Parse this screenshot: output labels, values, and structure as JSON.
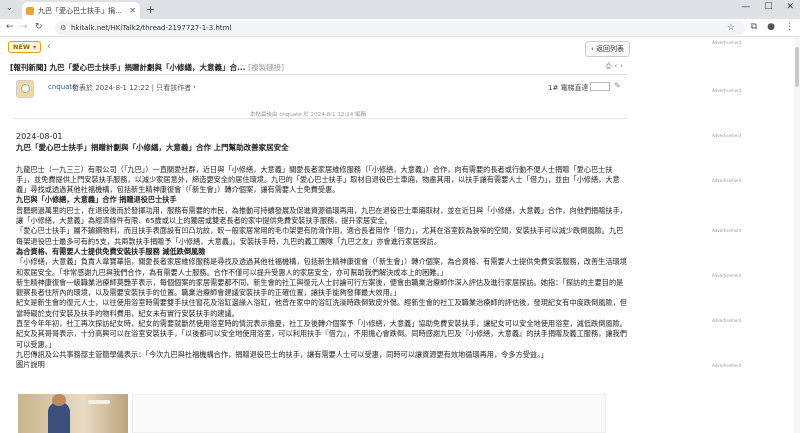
{
  "browser": {
    "tab_title": "九巴「愛心巴士扶手」捐贈計...",
    "url": "hkitalk.net/HKiTalk2/thread-2197727-1-3.html"
  },
  "topstrip": {
    "new_label": "NEW",
    "back_list": "返回列表"
  },
  "thread": {
    "title_prefix": "[報刊新聞]",
    "title": "九巴「愛心巴士扶手」捐贈計劃與「小修繕，大意義」合...",
    "copy_link": "[複製鏈接]"
  },
  "post": {
    "username": "cnquate",
    "posted": "發表於 2024-8-1 12:22  |  只看該作者",
    "floor": "1#",
    "jump_label": "電梯直達",
    "edit_note": "本帖最後由 cnquate 於 2024-8-1 12:24 編輯"
  },
  "article": {
    "date": "2024-08-01",
    "headline": "九巴「愛心巴士扶手」捐贈計劃與「小修繕，大意義」合作 上門幫助改善家居安全",
    "p1": "九龍巴士（一九三三）有限公司（「九巴」）一直關愛社群，近日與「小修繕，大意義」關愛長者家居維修服務（「小修繕，大意義」）合作，向有需要的長者或行動不便人士捐贈「愛心巴士扶手」，並免費提供上門安裝扶手服務，以減少家居意外，締造更安全的居住環境。九巴的「愛心巴士扶手」取材自退役巴士車廂，物盡其用，以扶手讓有需要人士「借力」，並由「小修繕，大意義」尋找或透過其他社福機構，包括新生精神康復會（「新生會」）轉介個案，讓有需要人士免費受惠。",
    "h2": "九巴與「小修繕，大意義」合作 捐贈退役巴士扶手",
    "p2": "曾聽網過萬里的巴士，在退役後而於發揮功用，服務有需要的市民，為推動可持續發展及促進資源循環再用，九巴在退役巴士車廂取材，並在近日與「小修繕，大意義」合作，向他們捐贈扶手，讓「小修繕，大意義」為經濟條件有限、65歲或以上的獨居或雙老長者的家中提供免費安裝扶手服務，提升家居安全。",
    "p3": "「愛心巴士扶手」屬不鏽鋼物料，而且扶手表面設有凹凸坑紋，較一般家居常用的毛巾架更有防滑作用，適合長者用作「借力」，尤其在浴室較為狹窄的空間，安裝扶手可以減少跌倒風險。九巴每架退役巴士最多可有約5支，共兩款扶手捐贈予「小修繕，大意義」。安裝扶手時，九巴的義工團隊「九巴之友」亦會進行家居探訪。",
    "h3": "為合資格、有需要人士提供免費安裝扶手服務 減低跌倒風險",
    "p4": "「小修繕，大意義」負責人韋寶華指，關愛長者家居維修服務是尋找及透過其他社福機構，包括新生精神康復會（「新生會」）轉介個案，為合資格、有需要人士提供免費安裝服務，改善生活環境和家居安全。「非常感謝九巴與我們合作，為有需要人士服務。合作不僅可以提升受惠人的家居安全，亦可幫助我們解決成本上的困難。」",
    "p5": "新生精神康復會一級職業治療師莫艷芋表示，每個個案的家居需要都不同，新生會的社工與復元人士討論可行方案後，便會由職業治療師作深入評估及進行家居探訪。她指：「探訪的主要目的是觀察長者住所內的環境，以及需要安裝扶手的位置。職業治療師會建議安裝扶手的正確位置，讓扶手能夠發揮最大效用。」",
    "p6": "紀女是新生會的復元人士，以往使用浴室時需要雙手扶住窗花及浴缸邊緣入浴缸，他曾在家中的浴缸洗澡時跌倒致皮外傷。經新生會的社工及職業治療師的評估後，發現紀女有中度跌倒風險，但當時礙於支付安裝及扶手的物料費用，紀女未有實行安裝扶手的建議。",
    "p7": "直至今年年初，社工再次探訪紀女時，紀女的需要就斷然使用浴室時的情況表示擔憂，社工及後轉介個案予「小修繕，大意義」協助免費安裝扶手，讓紀女可以安全地使用浴室，減低跌倒風險。紀女及其哥哥表示，十分高興可以在浴室安裝扶手，「以後都可以安全地使用浴室，可以利用扶手『借力』，不用擔心會跌倒。同時感謝九巴及『小修繕，大意義』的扶手捐贈及義工服務，讓我們可以受惠。」",
    "p8": "九巴傳訊及公共事務部主管簡學儀表示：「今次九巴與社福機構合作，捐贈退役巴士的扶手，讓有需要人士可以受惠，同時可以讓資源更有效地循環再用，令多方受益。」",
    "caption": "圖片說明"
  },
  "ads": {
    "label": "Advertisement"
  }
}
